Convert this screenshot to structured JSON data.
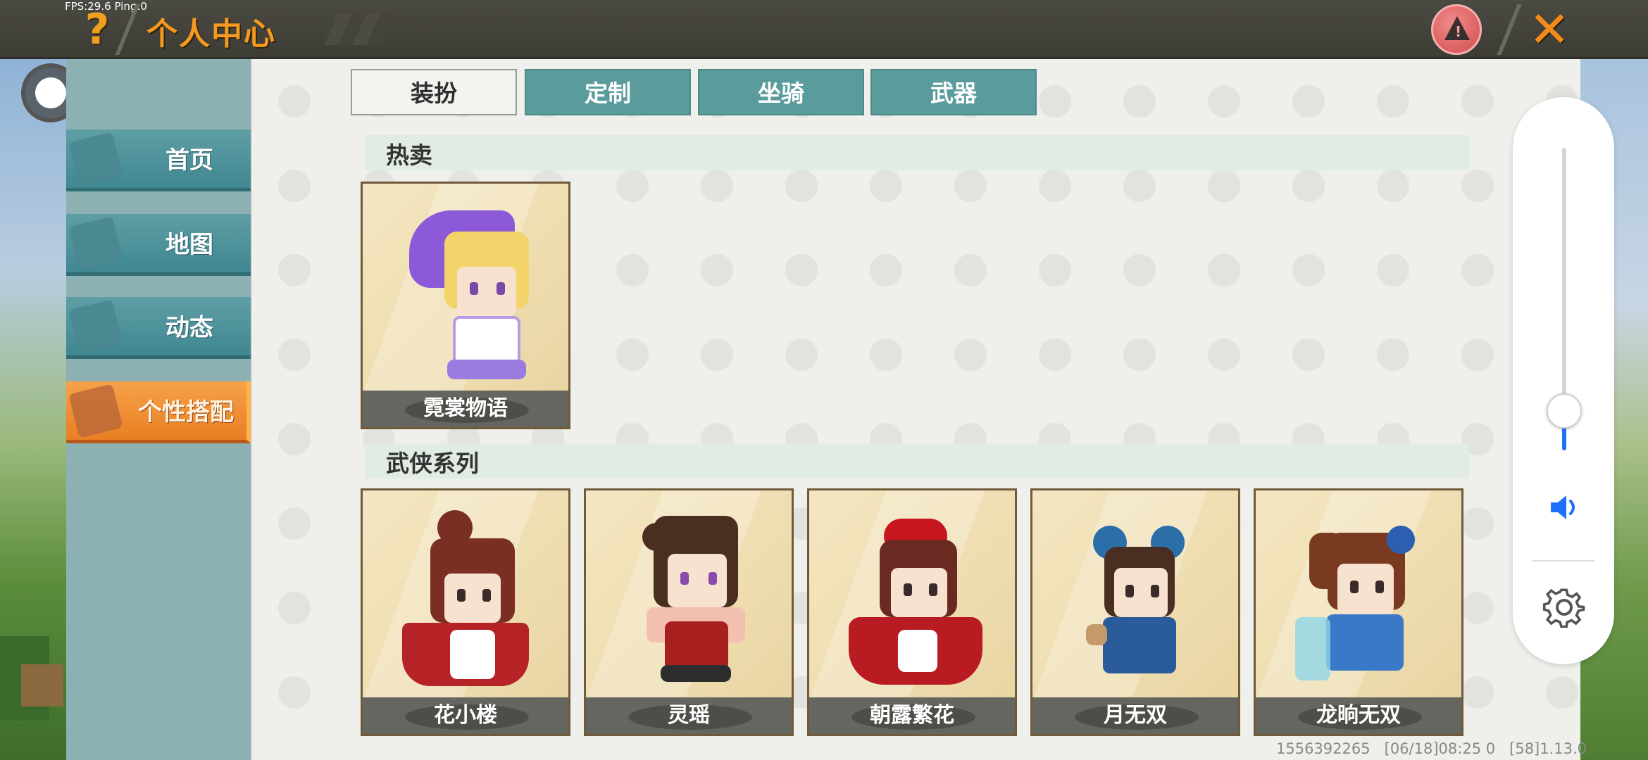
{
  "status": {
    "fps": "FPS:29.6",
    "ping": "Ping:0"
  },
  "header": {
    "title": "个人中心",
    "help_icon": "?",
    "close_icon": "✕"
  },
  "sidebar": {
    "items": [
      {
        "label": "首页",
        "icon": "home-icon",
        "active": false
      },
      {
        "label": "地图",
        "icon": "map-icon",
        "active": false
      },
      {
        "label": "动态",
        "icon": "bell-icon",
        "active": false
      },
      {
        "label": "个性搭配",
        "icon": "outfit-icon",
        "active": true
      }
    ]
  },
  "tabs": [
    {
      "label": "装扮",
      "active": true
    },
    {
      "label": "定制",
      "active": false
    },
    {
      "label": "坐骑",
      "active": false
    },
    {
      "label": "武器",
      "active": false
    }
  ],
  "sections": [
    {
      "title": "热卖",
      "items": [
        {
          "name": "霓裳物语"
        }
      ]
    },
    {
      "title": "武侠系列",
      "items": [
        {
          "name": "花小楼"
        },
        {
          "name": "灵瑶"
        },
        {
          "name": "朝露繁花"
        },
        {
          "name": "月无双"
        },
        {
          "name": "龙晌无双"
        }
      ]
    }
  ],
  "controls": {
    "volume_level": 0.13
  },
  "footer": {
    "uid": "1556392265",
    "datetime": "[06/18]08:25 0",
    "version": "[58]1.13.0"
  },
  "colors": {
    "accent_orange": "#f59a1e",
    "tab_teal": "#5a9c9b",
    "volume_blue": "#1f6fff"
  }
}
